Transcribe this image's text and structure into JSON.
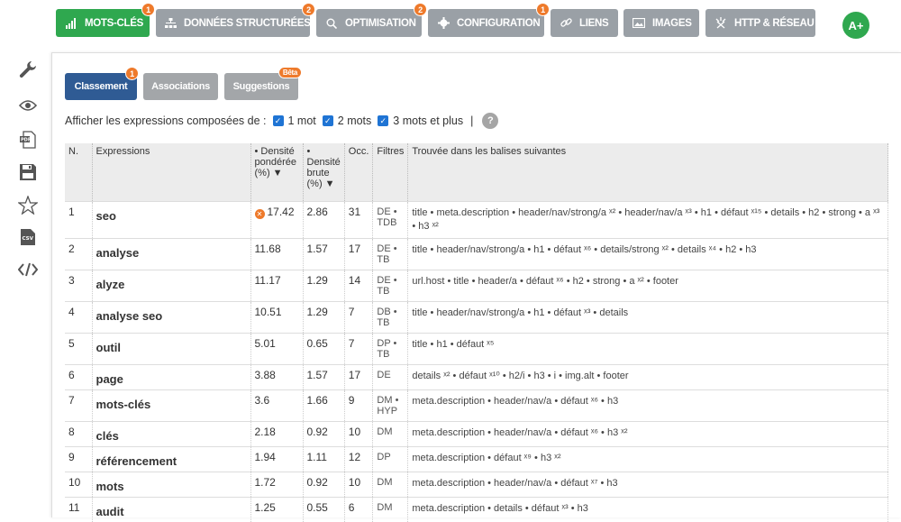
{
  "tabs": [
    {
      "label": "MOTS-CLÉS",
      "icon": "bar-chart-icon",
      "badge": "1",
      "active": true
    },
    {
      "label": "DONNÉES STRUCTURÉES",
      "icon": "sitemap-icon",
      "badge": "2",
      "active": false
    },
    {
      "label": "OPTIMISATION",
      "icon": "search-icon",
      "badge": "2",
      "active": false
    },
    {
      "label": "CONFIGURATION",
      "icon": "gear-icon",
      "badge": "1",
      "active": false
    },
    {
      "label": "LIENS",
      "icon": "link-icon",
      "badge": "",
      "active": false
    },
    {
      "label": "IMAGES",
      "icon": "image-icon",
      "badge": "",
      "active": false
    },
    {
      "label": "HTTP & RÉSEAU",
      "icon": "network-icon",
      "badge": "",
      "active": false
    }
  ],
  "grade": "A+",
  "sidebar": [
    "wrench-icon",
    "eye-icon",
    "pdf-icon",
    "save-icon",
    "star-icon",
    "csv-icon",
    "code-icon"
  ],
  "subtabs": [
    {
      "label": "Classement",
      "badge": "1",
      "active": true
    },
    {
      "label": "Associations",
      "badge": "",
      "active": false
    },
    {
      "label": "Suggestions",
      "badge": "Bêta",
      "active": false
    }
  ],
  "filter": {
    "prefix": "Afficher les expressions composées de :",
    "options": [
      "1 mot",
      "2 mots",
      "3 mots et plus"
    ],
    "separator": "|",
    "help": "?"
  },
  "table": {
    "headers": [
      "N.",
      "Expressions",
      "• Densité pondérée (%) ▼",
      "• Densité brute (%) ▼",
      "Occ.",
      "Filtres",
      "Trouvée dans les balises suivantes"
    ],
    "rows": [
      {
        "n": "1",
        "expr": "seo",
        "dp": "17.42",
        "warn": true,
        "db": "2.86",
        "occ": "31",
        "filt": "DE • TDB",
        "tags": "title • meta.description • header/nav/strong/a ˣ² • header/nav/a ˣ³ • h1 • défaut ˣ¹⁵ • details • h2 • strong • a ˣ³ • h3 ˣ²"
      },
      {
        "n": "2",
        "expr": "analyse",
        "dp": "11.68",
        "warn": false,
        "db": "1.57",
        "occ": "17",
        "filt": "DE • TB",
        "tags": "title • header/nav/strong/a • h1 • défaut ˣ⁶ • details/strong ˣ² • details ˣ⁴ • h2 • h3"
      },
      {
        "n": "3",
        "expr": "alyze",
        "dp": "11.17",
        "warn": false,
        "db": "1.29",
        "occ": "14",
        "filt": "DE • TB",
        "tags": "url.host • title • header/a • défaut ˣ⁶ • h2 • strong • a ˣ² • footer"
      },
      {
        "n": "4",
        "expr": "analyse seo",
        "dp": "10.51",
        "warn": false,
        "db": "1.29",
        "occ": "7",
        "filt": "DB • TB",
        "tags": "title • header/nav/strong/a • h1 • défaut ˣ³ • details"
      },
      {
        "n": "5",
        "expr": "outil",
        "dp": "5.01",
        "warn": false,
        "db": "0.65",
        "occ": "7",
        "filt": "DP • TB",
        "tags": "title • h1 • défaut ˣ⁵"
      },
      {
        "n": "6",
        "expr": "page",
        "dp": "3.88",
        "warn": false,
        "db": "1.57",
        "occ": "17",
        "filt": "DE",
        "tags": "details ˣ² • défaut ˣ¹⁰ • h2/i • h3 • i • img.alt • footer"
      },
      {
        "n": "7",
        "expr": "mots-clés",
        "dp": "3.6",
        "warn": false,
        "db": "1.66",
        "occ": "9",
        "filt": "DM • HYP",
        "tags": "meta.description • header/nav/a • défaut ˣ⁶ • h3"
      },
      {
        "n": "8",
        "expr": "clés",
        "dp": "2.18",
        "warn": false,
        "db": "0.92",
        "occ": "10",
        "filt": "DM",
        "tags": "meta.description • header/nav/a • défaut ˣ⁶ • h3 ˣ²"
      },
      {
        "n": "9",
        "expr": "référencement",
        "dp": "1.94",
        "warn": false,
        "db": "1.11",
        "occ": "12",
        "filt": "DP",
        "tags": "meta.description • défaut ˣ⁹ • h3 ˣ²"
      },
      {
        "n": "10",
        "expr": "mots",
        "dp": "1.72",
        "warn": false,
        "db": "0.92",
        "occ": "10",
        "filt": "DM",
        "tags": "meta.description • header/nav/a • défaut ˣ⁷ • h3"
      },
      {
        "n": "11",
        "expr": "audit",
        "dp": "1.25",
        "warn": false,
        "db": "0.55",
        "occ": "6",
        "filt": "DM",
        "tags": "meta.description • details • défaut ˣ³ • h3"
      }
    ]
  },
  "colors": {
    "active_tab": "#2fa84f",
    "inactive_tab": "#9aa0a6",
    "active_subtab": "#2f5b94",
    "badge": "#ee7a2b"
  }
}
